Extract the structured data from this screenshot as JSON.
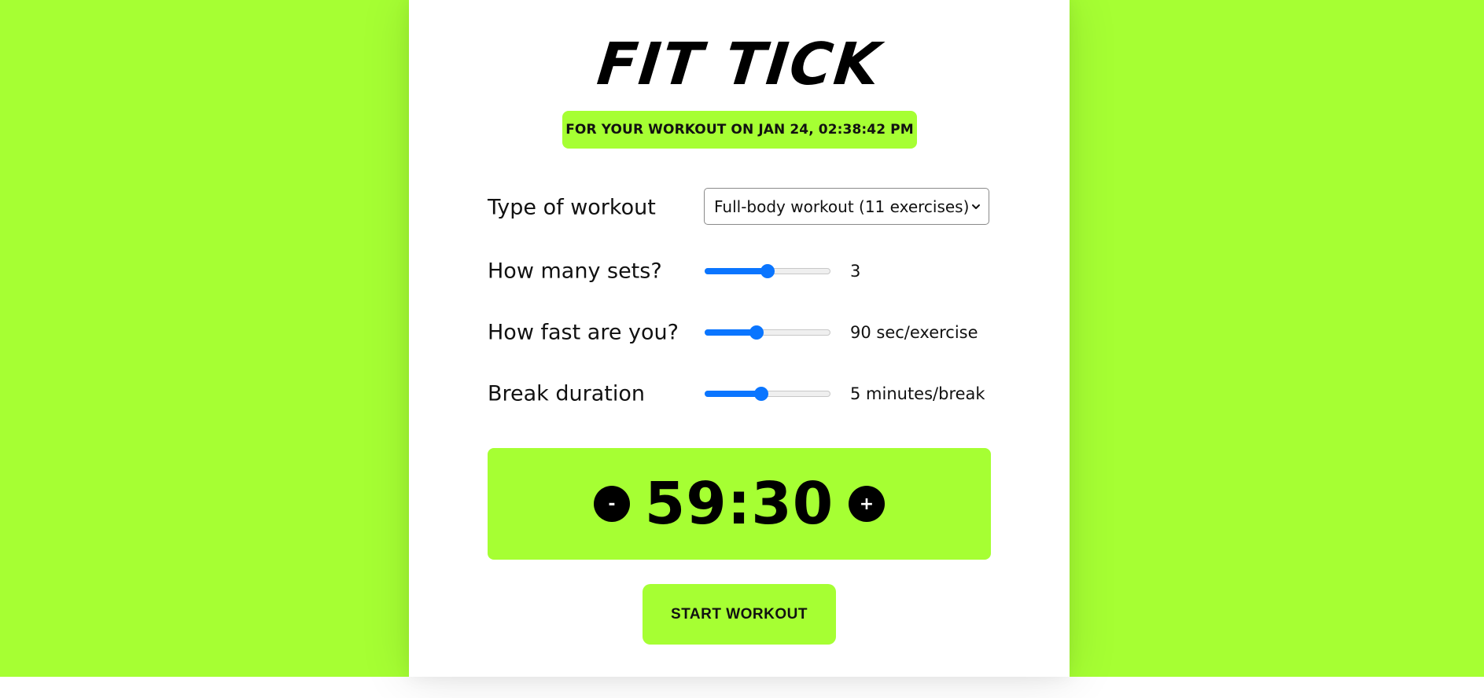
{
  "colors": {
    "accent_green": "#a6ff33",
    "slider_blue": "#0a75ff",
    "text": "#111111"
  },
  "app": {
    "title": "FIT TICK",
    "subtitle": "FOR YOUR WORKOUT ON JAN 24, 02:38:42 PM"
  },
  "form": {
    "workout_type": {
      "label": "Type of workout",
      "selected": "Full-body workout (11 exercises)",
      "icon": "chevron-down-icon"
    },
    "sets": {
      "label": "How many sets?",
      "value_text": "3",
      "slider_fraction": 0.5
    },
    "speed": {
      "label": "How fast are you?",
      "value_text": "90 sec/exercise",
      "slider_fraction": 0.41
    },
    "break": {
      "label": "Break duration",
      "value_text": "5 minutes/break",
      "slider_fraction": 0.45
    }
  },
  "timer": {
    "minus_label": "-",
    "plus_label": "+",
    "value": "59:30"
  },
  "actions": {
    "start_label": "START WORKOUT"
  }
}
